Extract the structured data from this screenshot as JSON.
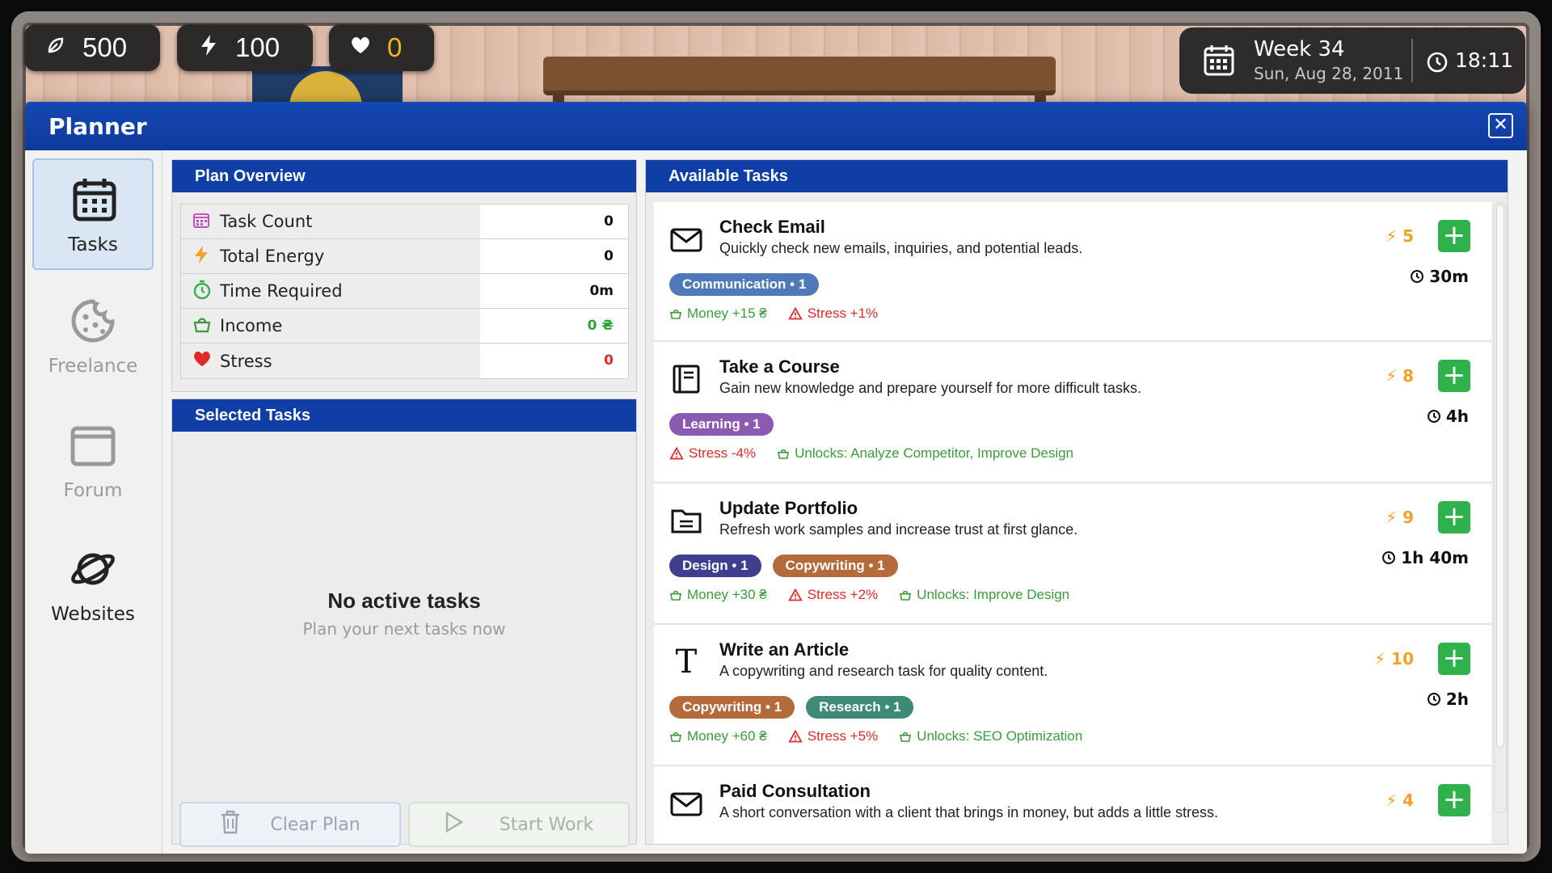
{
  "hud": {
    "money": "500",
    "energy": "100",
    "health": "0",
    "week": "Week 34",
    "date": "Sun, Aug 28, 2011",
    "time": "18:11"
  },
  "window": {
    "title": "Planner"
  },
  "sidebar": {
    "items": [
      {
        "label": "Tasks",
        "icon": "calendar-icon",
        "active": true
      },
      {
        "label": "Freelance",
        "icon": "cookie-icon",
        "active": false
      },
      {
        "label": "Forum",
        "icon": "window-icon",
        "active": false
      },
      {
        "label": "Websites",
        "icon": "planet-icon",
        "active": false
      }
    ]
  },
  "overview": {
    "title": "Plan Overview",
    "rows": [
      {
        "label": "Task Count",
        "value": "0",
        "icon": "calendar-icon",
        "color": "#c64fc0"
      },
      {
        "label": "Total Energy",
        "value": "0",
        "icon": "lightning-icon",
        "color": "#f0a12a"
      },
      {
        "label": "Time Required",
        "value": "0m",
        "icon": "stopwatch-icon",
        "color": "#2fb24c"
      },
      {
        "label": "Income",
        "value": "0 ₴",
        "icon": "bag-icon",
        "color": "#3a9a3a"
      },
      {
        "label": "Stress",
        "value": "0",
        "icon": "heart-icon",
        "color": "#dd2b2b"
      }
    ]
  },
  "selected": {
    "title": "Selected Tasks",
    "empty_title": "No active tasks",
    "empty_sub": "Plan your next tasks now",
    "clear_label": "Clear Plan",
    "start_label": "Start Work"
  },
  "available": {
    "title": "Available Tasks",
    "tasks": [
      {
        "name": "Check Email",
        "desc": "Quickly check new emails, inquiries, and potential leads.",
        "icon": "mail-icon",
        "energy": "5",
        "duration": "30m",
        "tags": [
          {
            "label": "Communication • 1",
            "color": "#4f79b8"
          }
        ],
        "effects": [
          {
            "text": "Money +15 ₴",
            "kind": "good"
          },
          {
            "text": "Stress +1%",
            "kind": "bad"
          }
        ]
      },
      {
        "name": "Take a Course",
        "desc": "Gain new knowledge and prepare yourself for more difficult tasks.",
        "icon": "book-icon",
        "energy": "8",
        "duration": "4h",
        "tags": [
          {
            "label": "Learning • 1",
            "color": "#8a5bb0"
          }
        ],
        "effects": [
          {
            "text": "Stress -4%",
            "kind": "bad"
          },
          {
            "text": "Unlocks: Analyze Competitor, Improve Design",
            "kind": "good"
          }
        ]
      },
      {
        "name": "Update Portfolio",
        "desc": "Refresh work samples and increase trust at first glance.",
        "icon": "folder-icon",
        "energy": "9",
        "duration": "1h 40m",
        "tags": [
          {
            "label": "Design • 1",
            "color": "#3f3f8f"
          },
          {
            "label": "Copywriting • 1",
            "color": "#b56a3c"
          }
        ],
        "effects": [
          {
            "text": "Money +30 ₴",
            "kind": "good"
          },
          {
            "text": "Stress +2%",
            "kind": "bad"
          },
          {
            "text": "Unlocks: Improve Design",
            "kind": "good"
          }
        ]
      },
      {
        "name": "Write an Article",
        "desc": "A copywriting and research task for quality content.",
        "icon": "text-icon",
        "energy": "10",
        "duration": "2h",
        "tags": [
          {
            "label": "Copywriting • 1",
            "color": "#b56a3c"
          },
          {
            "label": "Research • 1",
            "color": "#3e8a77"
          }
        ],
        "effects": [
          {
            "text": "Money +60 ₴",
            "kind": "good"
          },
          {
            "text": "Stress +5%",
            "kind": "bad"
          },
          {
            "text": "Unlocks: SEO Optimization",
            "kind": "good"
          }
        ]
      },
      {
        "name": "Paid Consultation",
        "desc": "A short conversation with a client that brings in money, but adds a little stress.",
        "icon": "mail-icon",
        "energy": "4",
        "duration": "",
        "tags": [],
        "effects": []
      }
    ]
  }
}
